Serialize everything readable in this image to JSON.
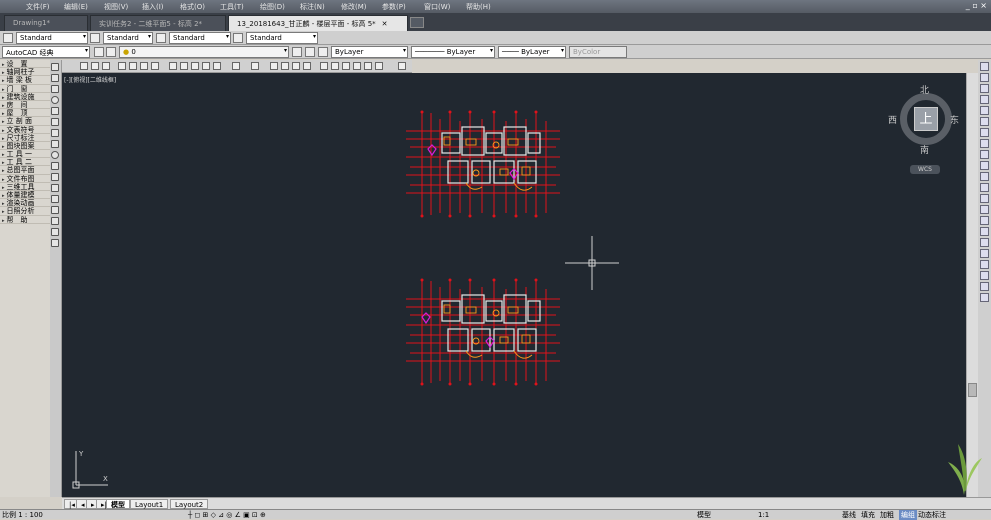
{
  "menu": [
    "文件(F)",
    "编辑(E)",
    "视图(V)",
    "插入(I)",
    "格式(O)",
    "工具(T)",
    "绘图(D)",
    "标注(N)",
    "修改(M)",
    "参数(P)",
    "窗口(W)",
    "帮助(H)"
  ],
  "window_controls": "_ ▫ ×",
  "doc_tabs": [
    {
      "label": "Drawing1*",
      "active": false
    },
    {
      "label": "实训任务2 - 二维平面5 - 标高 2*",
      "active": false
    },
    {
      "label": "13_20181643_甘正麟 - 楼层平面 - 标高 5*",
      "active": true
    }
  ],
  "toolbar1": {
    "text_style": "Standard",
    "dim_style": "Standard",
    "table_style": "Standard",
    "multileader_style": "Standard"
  },
  "toolbar2": {
    "workspace": "AutoCAD 经典",
    "layer": "0",
    "color": "ByLayer",
    "linetype": "ByLayer",
    "lineweight": "ByLayer",
    "plotstyle": "ByColor"
  },
  "left_menu": [
    "设　置",
    "轴网柱子",
    "墙 梁 板",
    "门　窗",
    "建筑设施",
    "房　间",
    "屋　顶",
    "立 剖 面",
    "文表符号",
    "尺寸标注",
    "图块图案",
    "工 具 一",
    "工 具 二",
    "总图平面",
    "文件布图",
    "三维工具",
    "体量建模",
    "渲染动画",
    "日照分析",
    "帮　助"
  ],
  "viewport_label": "[-][俯视][二维线框]",
  "viewcube": {
    "north": "北",
    "south": "南",
    "east": "东",
    "west": "西",
    "top": "上",
    "wcs": "WCS"
  },
  "layout_tabs": [
    "模型",
    "Layout1",
    "Layout2"
  ],
  "status": {
    "scale": "比例 1 : 100",
    "right_items": [
      "模型",
      "1:1",
      "基线",
      "填充",
      "加粗",
      "编组",
      "动态标注"
    ]
  },
  "colors": {
    "canvas": "#212830",
    "wall": "#e0121a",
    "furniture": "#ff9a1c",
    "accent": "#d81fd8"
  }
}
